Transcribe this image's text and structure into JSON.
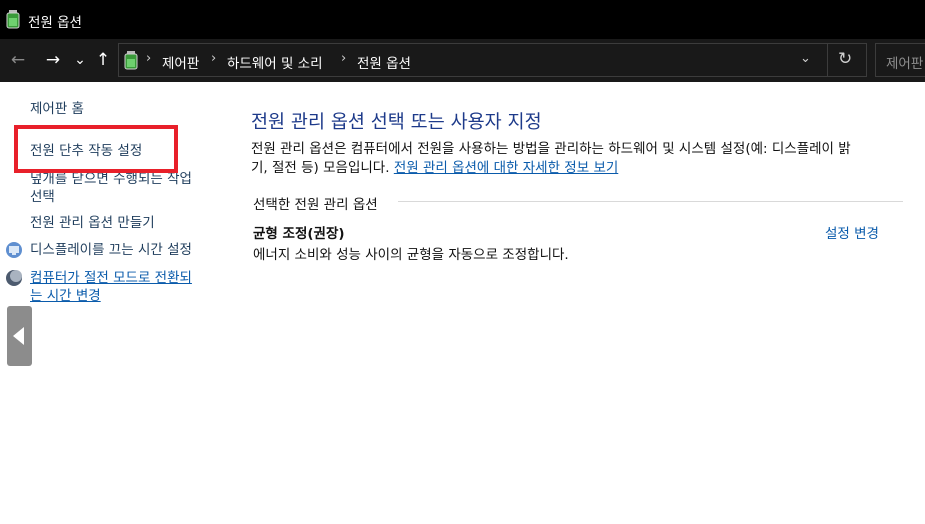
{
  "window": {
    "title": "전원 옵션",
    "icon": "battery-plug-icon"
  },
  "nav": {
    "back": "←",
    "forward": "→",
    "recent": "⌄",
    "up": "↑",
    "breadcrumb": [
      "제어판",
      "하드웨어 및 소리",
      "전원 옵션"
    ],
    "dropdown": "⌄",
    "refresh": "↻",
    "search_placeholder": "제어판 검색"
  },
  "sidebar": {
    "home": "제어판 홈",
    "links": [
      "전원 단추 작동 설정",
      "덮개를 닫으면 수행되는 작업",
      "선택",
      "전원 관리 옵션 만들기",
      "디스플레이를 끄는 시간 설정",
      "컴퓨터가 절전 모드로 전환되",
      "는 시간 변경"
    ]
  },
  "main": {
    "heading": "전원 관리 옵션 선택 또는 사용자 지정",
    "description_line1": "전원 관리 옵션은 컴퓨터에서 전원을 사용하는 방법을 관리하는 하드웨어 및 시스템 설정(예: 디스플레이 밝",
    "description_line2": "기, 절전 등) 모음입니다.",
    "description_link": "전원 관리 옵션에 대한 자세한 정보 보기",
    "group_label": "선택한 전원 관리 옵션",
    "plan_name": "균형 조정(권장)",
    "plan_description": "에너지 소비와 성능 사이의 균형을 자동으로 조정합니다.",
    "change_settings": "설정 변경"
  },
  "colors": {
    "highlight": "#e8202a",
    "link": "#0a5bab",
    "heading": "#1d3a8a",
    "titlebar": "#000000"
  }
}
